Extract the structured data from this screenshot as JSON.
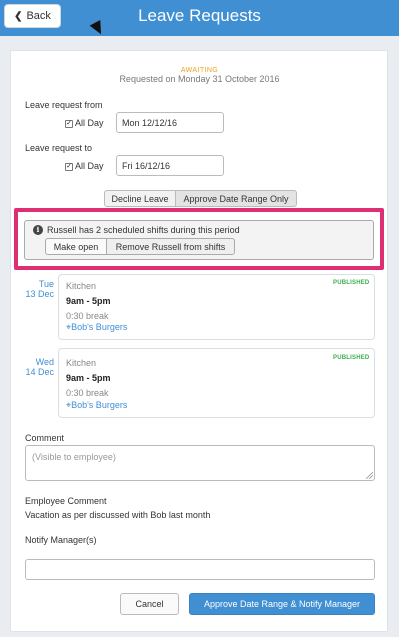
{
  "header": {
    "title": "Leave Requests",
    "back_label": "Back"
  },
  "request": {
    "status": "AWAITING",
    "requested_text": "Requested on Monday 31 October 2016"
  },
  "from": {
    "label": "Leave request from",
    "all_day_label": "All Day",
    "all_day_checked": true,
    "date_value": "Mon 12/12/16"
  },
  "to": {
    "label": "Leave request to",
    "all_day_label": "All Day",
    "all_day_checked": true,
    "date_value": "Fri 16/12/16"
  },
  "actions": {
    "decline_label": "Decline Leave",
    "approve_range_label": "Approve Date Range Only"
  },
  "alert": {
    "message": "Russell has 2 scheduled shifts during this period",
    "make_open_label": "Make open",
    "remove_label": "Remove Russell from shifts",
    "highlight_color": "#de2f73"
  },
  "shifts": [
    {
      "day": "Tue",
      "date": "13 Dec",
      "area": "Kitchen",
      "time": "9am - 5pm",
      "break": "0:30 break",
      "location": "Bob's Burgers",
      "status": "PUBLISHED"
    },
    {
      "day": "Wed",
      "date": "14 Dec",
      "area": "Kitchen",
      "time": "9am - 5pm",
      "break": "0:30 break",
      "location": "Bob's Burgers",
      "status": "PUBLISHED"
    }
  ],
  "comment": {
    "label": "Comment",
    "placeholder": "(Visible to employee)"
  },
  "employee_comment": {
    "label": "Employee Comment",
    "text": "Vacation as per discussed with Bob last month"
  },
  "notify": {
    "label": "Notify Manager(s)",
    "value": ""
  },
  "footer": {
    "cancel_label": "Cancel",
    "primary_label": "Approve Date Range & Notify Manager"
  },
  "colors": {
    "brand_blue": "#3f8fd2",
    "awaiting_orange": "#f0a020",
    "published_green": "#3cae4f"
  }
}
